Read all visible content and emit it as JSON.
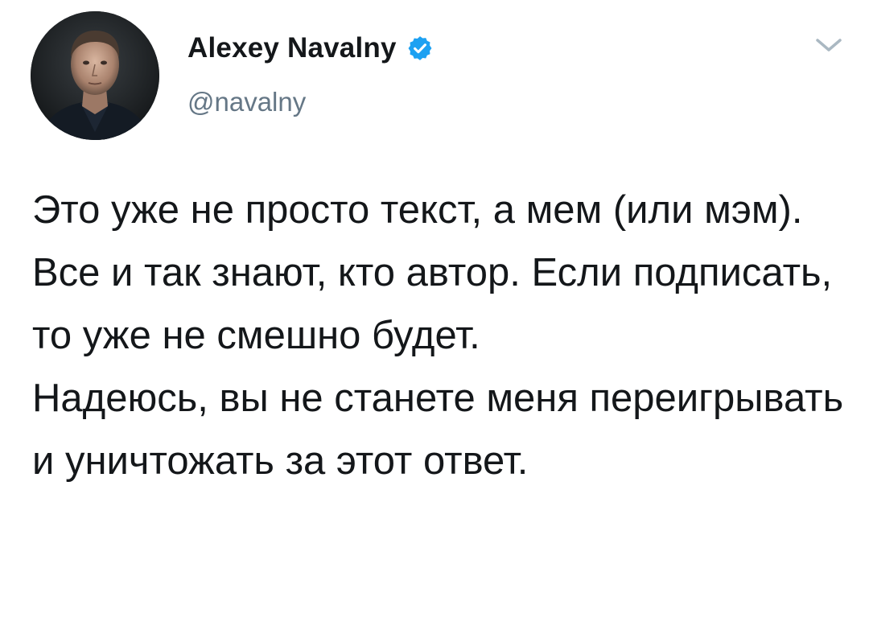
{
  "author": {
    "display_name": "Alexey Navalny",
    "handle": "@navalny",
    "verified": true
  },
  "tweet": {
    "text": "Это уже не просто текст, а мем (или мэм). Все и так знают, кто автор. Если подписать, то уже не смешно будет.\nНадеюсь, вы не станете меня переигрывать и уничтожать за этот ответ."
  },
  "icons": {
    "verified": "verified-badge-icon",
    "menu": "chevron-down-icon"
  },
  "colors": {
    "text": "#14171a",
    "secondary": "#657786",
    "verified_blue": "#1da1f2",
    "caret": "#aab8c2"
  }
}
